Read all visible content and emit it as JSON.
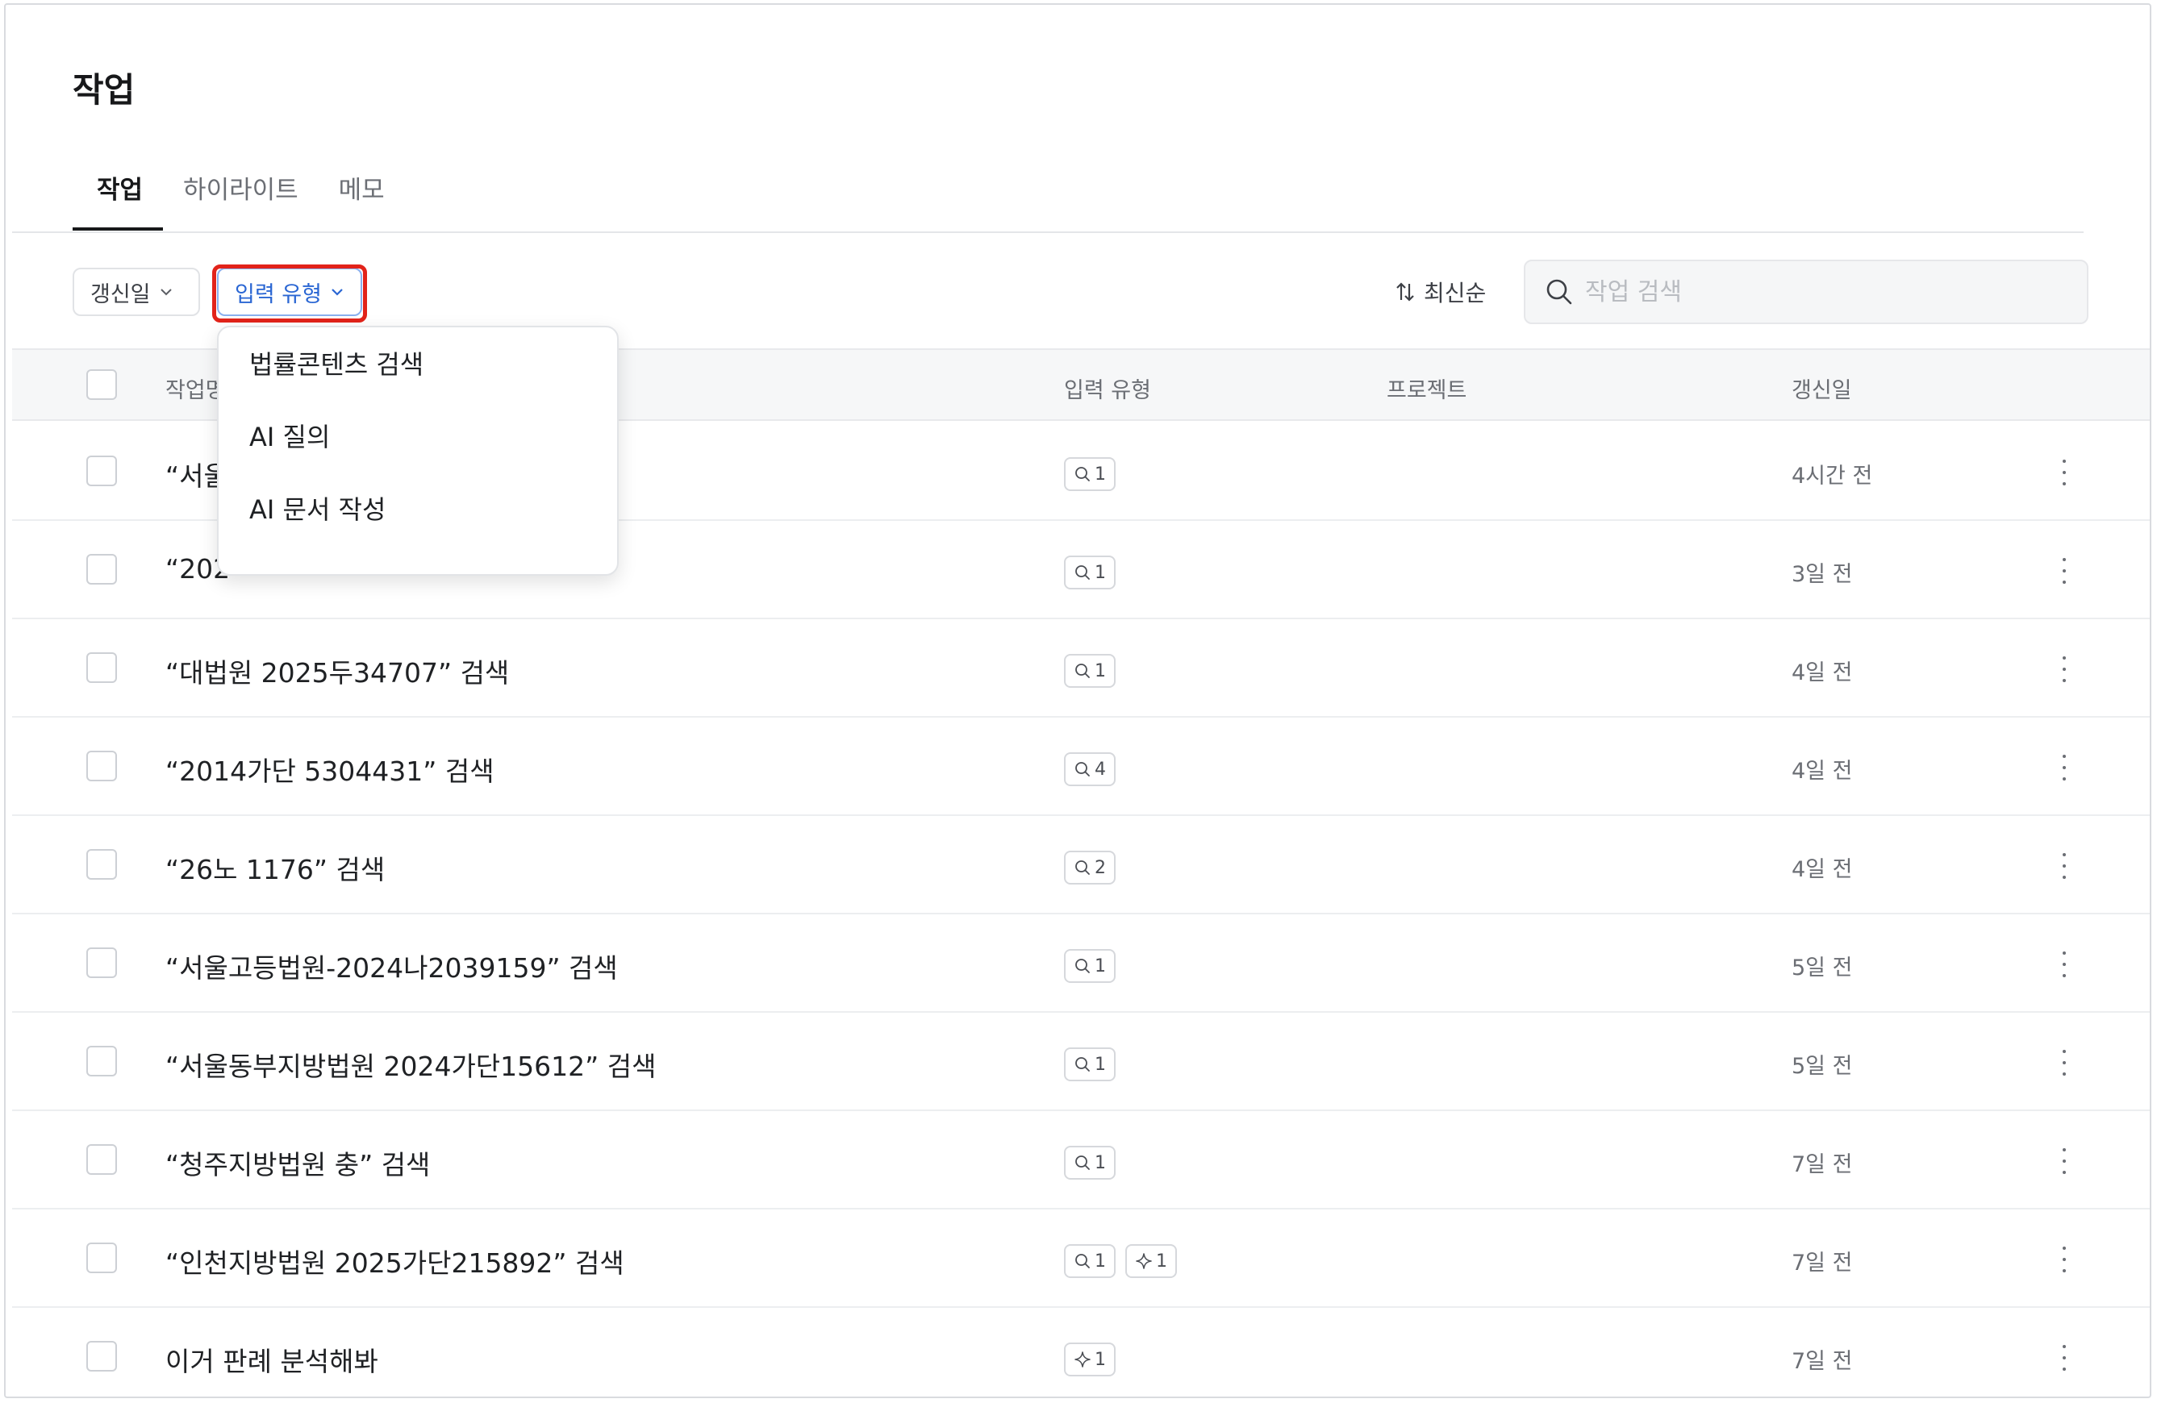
{
  "page": {
    "title": "작업"
  },
  "tabs": [
    {
      "label": "작업"
    },
    {
      "label": "하이라이트"
    },
    {
      "label": "메모"
    }
  ],
  "filters": {
    "date_label": "갱신일",
    "input_type_label": "입력 유형"
  },
  "sort": {
    "label": "최신순"
  },
  "search": {
    "placeholder": "작업 검색",
    "value": ""
  },
  "table": {
    "headers": {
      "title": "작업명",
      "input_type": "입력 유형",
      "project": "프로젝트",
      "updated": "갱신일"
    },
    "rows": [
      {
        "title": "“서울",
        "tags": [
          {
            "icon": "search-icon",
            "count": "1"
          }
        ],
        "date": "4시간 전"
      },
      {
        "title": "“202",
        "tags": [
          {
            "icon": "search-icon",
            "count": "1"
          }
        ],
        "date": "3일 전"
      },
      {
        "title": "“대법원 2025두34707” 검색",
        "tags": [
          {
            "icon": "search-icon",
            "count": "1"
          }
        ],
        "date": "4일 전"
      },
      {
        "title": "“2014가단 5304431” 검색",
        "tags": [
          {
            "icon": "search-icon",
            "count": "4"
          }
        ],
        "date": "4일 전"
      },
      {
        "title": "“26노 1176” 검색",
        "tags": [
          {
            "icon": "search-icon",
            "count": "2"
          }
        ],
        "date": "4일 전"
      },
      {
        "title": "“서울고등법원-2024나2039159” 검색",
        "tags": [
          {
            "icon": "search-icon",
            "count": "1"
          }
        ],
        "date": "5일 전"
      },
      {
        "title": "“서울동부지방법원 2024가단15612” 검색",
        "tags": [
          {
            "icon": "search-icon",
            "count": "1"
          }
        ],
        "date": "5일 전"
      },
      {
        "title": "“청주지방법원 충” 검색",
        "tags": [
          {
            "icon": "search-icon",
            "count": "1"
          }
        ],
        "date": "7일 전"
      },
      {
        "title": "“인천지방법원 2025가단215892” 검색",
        "tags": [
          {
            "icon": "search-icon",
            "count": "1"
          },
          {
            "icon": "sparkle-icon",
            "count": "1"
          }
        ],
        "date": "7일 전"
      },
      {
        "title": "이거 판례 분석해봐",
        "tags": [
          {
            "icon": "sparkle-icon",
            "count": "1"
          }
        ],
        "date": "7일 전"
      }
    ]
  },
  "dropdown": {
    "items": [
      {
        "label": "법률콘텐츠 검색"
      },
      {
        "label": "AI 질의"
      },
      {
        "label": "AI 문서 작성"
      }
    ]
  },
  "colors": {
    "accent": "#2a66d3",
    "highlight": "#e2231a"
  }
}
